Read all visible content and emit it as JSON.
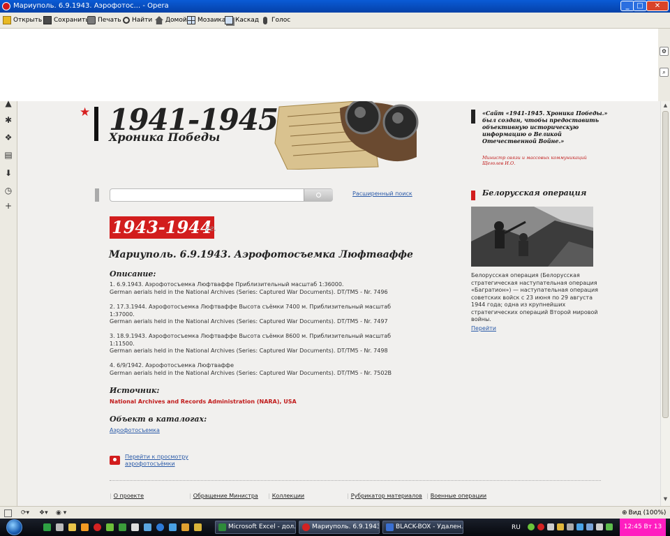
{
  "window": {
    "title": "Мариуполь. 6.9.1943. Аэрофотос... - Opera"
  },
  "toolbar": {
    "open": "Открыть",
    "save": "Сохранить",
    "print": "Печать",
    "find": "Найти",
    "home": "Домой",
    "mosaic": "Мозаика",
    "cascade": "Каскад",
    "voice": "Голос"
  },
  "site": {
    "years": "1941-1945",
    "subtitle": "Хроника Победы",
    "quote": "«Сайт «1941-1945. Хроника Победы.» был создан, чтобы предоставить объективную историческую информацию о Великой Отечественной Войне.»",
    "quote_author": "Министр связи и массовых коммуникаций Щеголев И.О."
  },
  "search": {
    "placeholder": "",
    "advanced": "Расширенный поиск"
  },
  "article": {
    "year_badge": "1943-1944",
    "year_suffix": "гг.",
    "title": "Мариуполь. 6.9.1943. Аэрофотосъемка Люфтваффе",
    "desc_heading": "Описание:",
    "items": [
      {
        "line1": "1. 6.9.1943. Аэрофотосъемка Люфтваффе Приблизительный масштаб 1:36000.",
        "line2": "German aerials held in the National Archives (Series: Captured War Documents). DT/TM5 - Nr. 7496"
      },
      {
        "line1": "2. 17.3.1944. Аэрофотосъемка Люфтваффе Высота съёмки 7400 м. Приблизительный масштаб 1:37000.",
        "line2": "German aerials held in the National Archives (Series: Captured War Documents). DT/TM5 - Nr. 7497"
      },
      {
        "line1": "3. 18.9.1943. Аэрофотосъемка Люфтваффе Высота съёмки 8600 м. Приблизительный масштаб 1:11500.",
        "line2": "German aerials held in the National Archives (Series: Captured War Documents). DT/TM5 - Nr. 7498"
      },
      {
        "line1": "4. 6/9/1942. Аэрофотосъемка Люфтваффе",
        "line2": "German aerials held in the National Archives (Series: Captured War Documents). DT/TM5 - Nr. 7502B"
      }
    ],
    "source_heading": "Источник:",
    "source": "National Archives and Records Administration (NARA), USA",
    "catalog_heading": "Объект в каталогах:",
    "catalog_link": "Аэрофотосъемка",
    "view_link": "Перейти к просмотру аэрофотосъёмки"
  },
  "sidebar": {
    "title": "Белорусская операция",
    "text": "Белорусская операция (Белорусская стратегическая наступательная операция «Багратион») — наступательная операция советских войск с 23 июня по 29 августа 1944 года; одна из крупнейших стратегических операций Второй мировой войны.",
    "link": "Перейти"
  },
  "footer_nav": [
    "О проекте",
    "Обращение Министра",
    "Коллекции",
    "Рубрикатор материалов",
    "Военные операции"
  ],
  "statusbar": {
    "zoom": "Вид (100%)"
  },
  "taskbar": {
    "tasks": [
      "Microsoft Excel - дол...",
      "Мариуполь. 6.9.1943....",
      "BLACK-BOX - Удален..."
    ],
    "lang": "RU",
    "clock": "12:45 Вт 13"
  },
  "colors": {
    "accent": "#d21d1d",
    "link": "#2a5aa8",
    "clock_bg": "#ff1ec0"
  }
}
